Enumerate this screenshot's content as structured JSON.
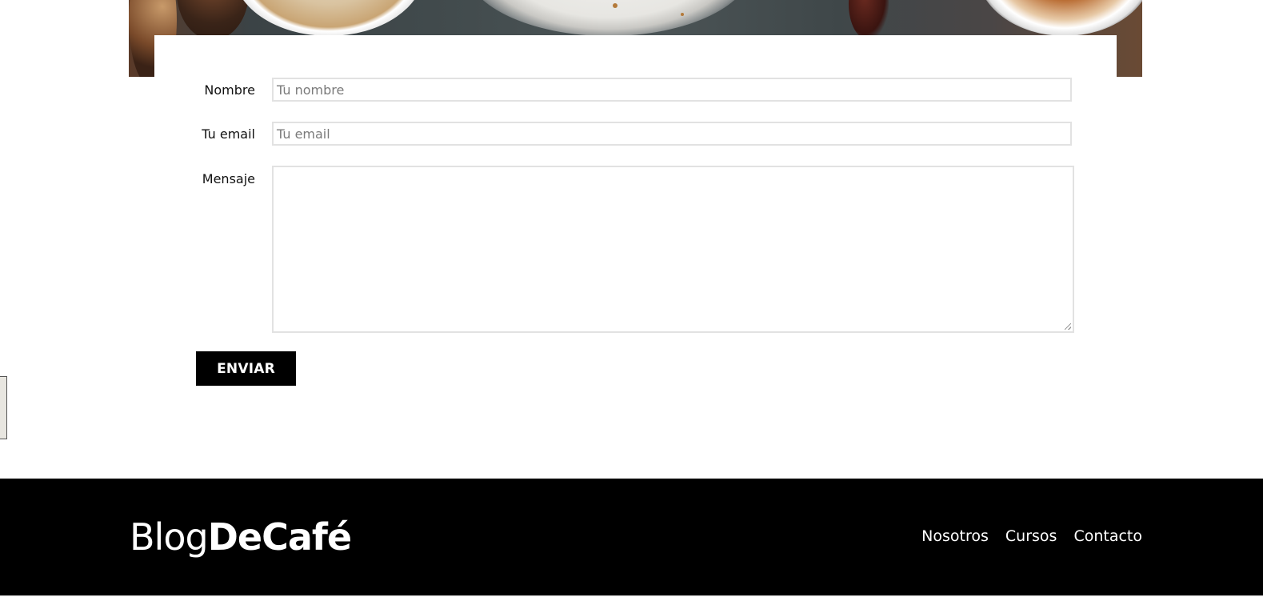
{
  "form": {
    "name_label": "Nombre",
    "name_placeholder": "Tu nombre",
    "email_label": "Tu email",
    "email_placeholder": "Tu email",
    "message_label": "Mensaje",
    "message_value": "",
    "submit_label": "ENVIAR"
  },
  "footer": {
    "logo_light": "Blog",
    "logo_bold": "DeCafé",
    "nav": [
      {
        "label": "Nosotros"
      },
      {
        "label": "Cursos"
      },
      {
        "label": "Contacto"
      }
    ]
  },
  "colors": {
    "footer_bg": "#000000",
    "button_bg": "#000000",
    "input_border": "#e2e2e2"
  }
}
